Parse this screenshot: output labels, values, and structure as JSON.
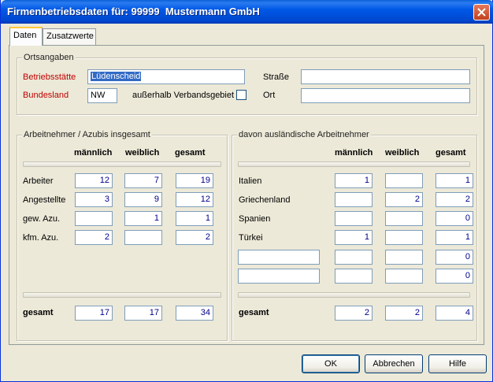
{
  "window": {
    "title": "Firmenbetriebsdaten für: 99999  Mustermann GmbH"
  },
  "tabs": [
    {
      "label": "Daten"
    },
    {
      "label": "Zusatzwerte"
    }
  ],
  "ortsangaben": {
    "label": "Ortsangaben",
    "betriebsstaette_label": "Betriebsstätte",
    "betriebsstaette_value": "Lüdenscheid",
    "bundesland_label": "Bundesland",
    "bundesland_value": "NW",
    "ausserhalb_label": "außerhalb Verbandsgebiet",
    "ausserhalb_checked": false,
    "strasse_label": "Straße",
    "strasse_value": "",
    "ort_label": "Ort",
    "ort_value": ""
  },
  "left_group": {
    "label": "Arbeitnehmer / Azubis insgesamt",
    "headers": [
      "männlich",
      "weiblich",
      "gesamt"
    ],
    "rows": [
      {
        "label": "Arbeiter",
        "m": "12",
        "w": "7",
        "g": "19"
      },
      {
        "label": "Angestellte",
        "m": "3",
        "w": "9",
        "g": "12"
      },
      {
        "label": "gew. Azu.",
        "m": "",
        "w": "1",
        "g": "1"
      },
      {
        "label": "kfm. Azu.",
        "m": "2",
        "w": "",
        "g": "2"
      }
    ],
    "total": {
      "label": "gesamt",
      "m": "17",
      "w": "17",
      "g": "34"
    }
  },
  "right_group": {
    "label": "davon ausländische Arbeitnehmer",
    "headers": [
      "männlich",
      "weiblich",
      "gesamt"
    ],
    "rows": [
      {
        "label": "Italien",
        "m": "1",
        "w": "",
        "g": "1"
      },
      {
        "label": "Griechenland",
        "m": "",
        "w": "2",
        "g": "2"
      },
      {
        "label": "Spanien",
        "m": "",
        "w": "",
        "g": "0"
      },
      {
        "label": "Türkei",
        "m": "1",
        "w": "",
        "g": "1"
      },
      {
        "label": "",
        "m": "",
        "w": "",
        "g": "0"
      },
      {
        "label": "",
        "m": "",
        "w": "",
        "g": "0"
      }
    ],
    "total": {
      "label": "gesamt",
      "m": "2",
      "w": "2",
      "g": "4"
    }
  },
  "buttons": {
    "ok": "OK",
    "abbrechen": "Abbrechen",
    "hilfe": "Hilfe"
  },
  "colors": {
    "title_bar": "#0058e6",
    "required_label": "#c00000",
    "value_text": "#00008b"
  }
}
